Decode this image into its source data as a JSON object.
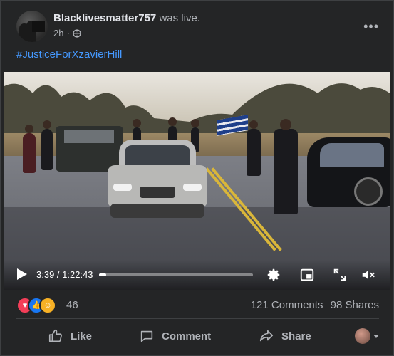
{
  "post": {
    "author": "Blacklivesmatter757",
    "status": "was live.",
    "time": "2h",
    "audience_icon": "globe-icon",
    "more_icon": "more-options-icon",
    "hashtag": "#JusticeForXzavierHill"
  },
  "video": {
    "current_time": "3:39",
    "separator": " / ",
    "duration": "1:22:43",
    "progress_fraction": 0.044,
    "icons": [
      "play-icon",
      "settings-gear-icon",
      "picture-in-picture-icon",
      "fullscreen-icon",
      "volume-muted-icon"
    ]
  },
  "engagement": {
    "reaction_icons": [
      "love-icon",
      "like-icon",
      "care-icon"
    ],
    "reaction_count": "46",
    "comments": "121 Comments",
    "shares": "98 Shares"
  },
  "actions": {
    "like": "Like",
    "comment": "Comment",
    "share": "Share"
  },
  "colors": {
    "background": "#242526",
    "link": "#4599ff",
    "text_primary": "#e4e6eb",
    "text_secondary": "#b0b3b8"
  }
}
